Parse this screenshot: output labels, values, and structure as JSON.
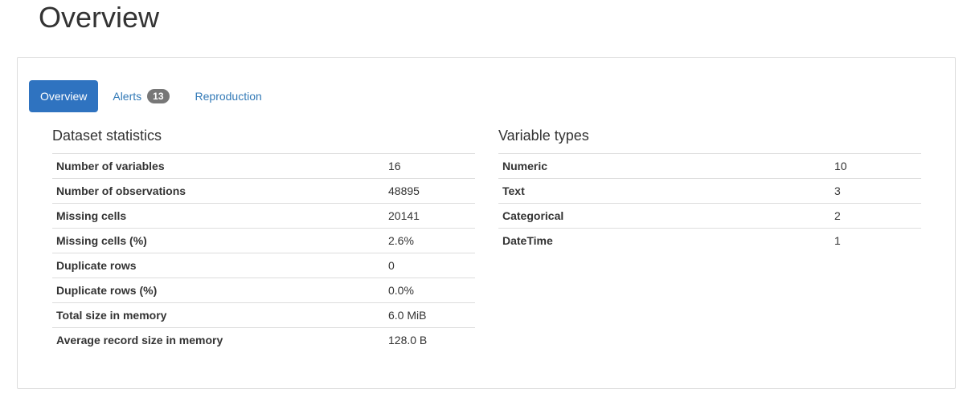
{
  "page": {
    "title": "Overview"
  },
  "tabs": [
    {
      "label": "Overview",
      "active": true
    },
    {
      "label": "Alerts",
      "badge": "13",
      "active": false
    },
    {
      "label": "Reproduction",
      "active": false
    }
  ],
  "dataset_statistics": {
    "title": "Dataset statistics",
    "rows": [
      {
        "label": "Number of variables",
        "value": "16"
      },
      {
        "label": "Number of observations",
        "value": "48895"
      },
      {
        "label": "Missing cells",
        "value": "20141"
      },
      {
        "label": "Missing cells (%)",
        "value": "2.6%"
      },
      {
        "label": "Duplicate rows",
        "value": "0"
      },
      {
        "label": "Duplicate rows (%)",
        "value": "0.0%"
      },
      {
        "label": "Total size in memory",
        "value": "6.0 MiB"
      },
      {
        "label": "Average record size in memory",
        "value": "128.0 B"
      }
    ]
  },
  "variable_types": {
    "title": "Variable types",
    "rows": [
      {
        "label": "Numeric",
        "value": "10"
      },
      {
        "label": "Text",
        "value": "3"
      },
      {
        "label": "Categorical",
        "value": "2"
      },
      {
        "label": "DateTime",
        "value": "1"
      }
    ]
  },
  "colors": {
    "accent": "#2f73c0",
    "link": "#337ab7",
    "badge": "#777777",
    "border": "#dddddd"
  }
}
